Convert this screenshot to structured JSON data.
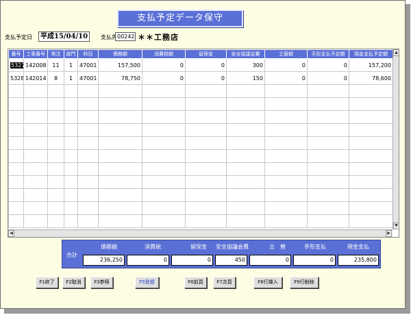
{
  "window": {
    "title": "支払予定データ保守"
  },
  "header": {
    "date_label": "支払予定日",
    "date_value": "平成15/04/10",
    "vendor_label": "支払先",
    "vendor_code": "00242",
    "vendor_name": "＊＊工務店"
  },
  "grid": {
    "columns": [
      "番号",
      "工事番号",
      "発注",
      "部門",
      "科目",
      "債務額",
      "消費税額",
      "留保金",
      "安全協議会費",
      "立替額",
      "手形支払予定額",
      "現金支払予定額"
    ],
    "rows": [
      [
        "5327",
        "142008",
        "11",
        "1",
        "47001",
        "157,500",
        "0",
        "0",
        "300",
        "0",
        "0",
        "157,200"
      ],
      [
        "5328",
        "142014",
        "8",
        "1",
        "47001",
        "78,750",
        "0",
        "0",
        "150",
        "0",
        "0",
        "78,600"
      ]
    ]
  },
  "totals": {
    "label": "合計",
    "headers": [
      "債務額",
      "消費税",
      "留保金",
      "安全協議会費",
      "立　替",
      "手形支払",
      "現金支払"
    ],
    "values": [
      "236,250",
      "0",
      "0",
      "450",
      "0",
      "0",
      "235,800"
    ]
  },
  "buttons": {
    "f1": "F1終了",
    "f2": "F2取消",
    "f3": "F3参照",
    "f5": "F5登録",
    "f6": "F6前頁",
    "f7": "F7次頁",
    "f8": "F8行挿入",
    "f9": "F9行削除"
  },
  "colors": {
    "accent": "#5a70d6",
    "background": "#fdfde4",
    "f5_text": "#2a3fc8"
  }
}
